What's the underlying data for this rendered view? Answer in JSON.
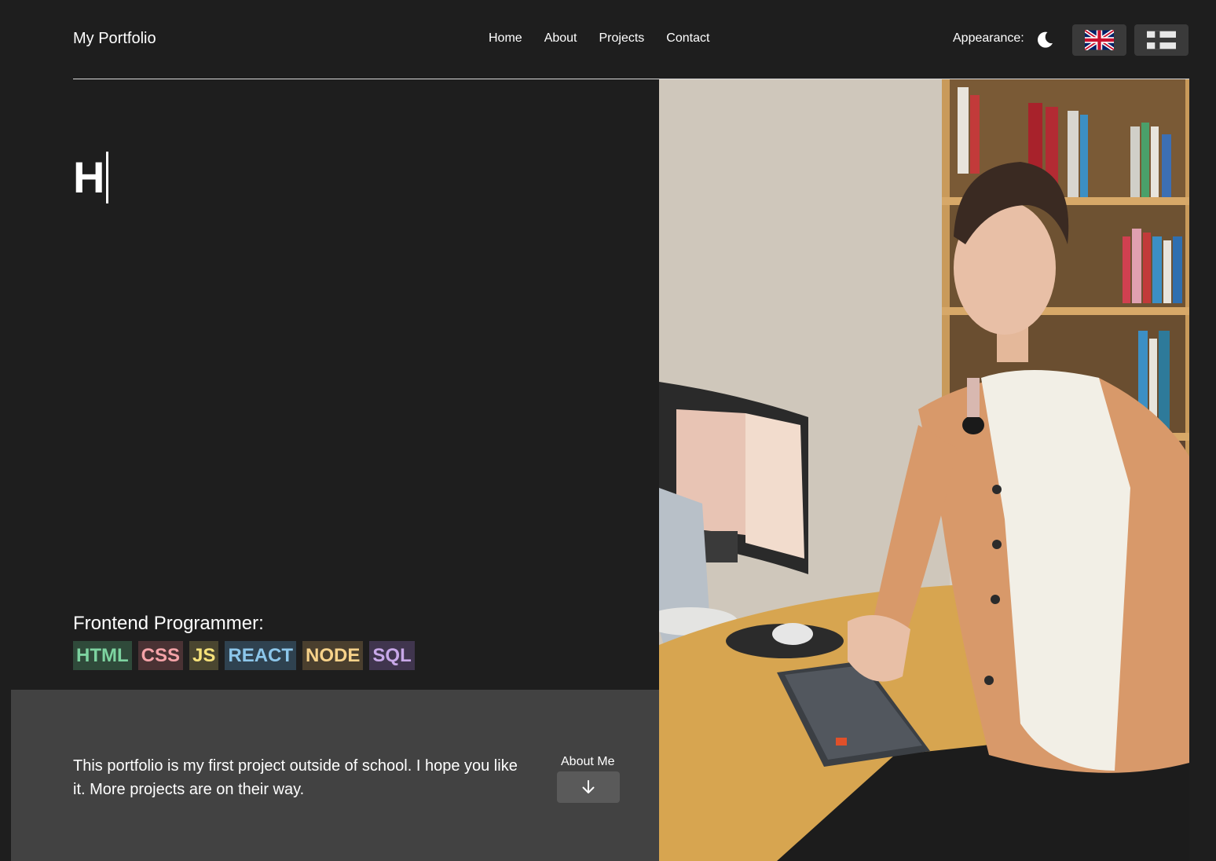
{
  "header": {
    "brand": "My Portfolio",
    "nav": [
      "Home",
      "About",
      "Projects",
      "Contact"
    ],
    "appearance_label": "Appearance:",
    "theme_icon": "moon-icon",
    "languages": [
      "English (UK flag)",
      "Finnish (flag)"
    ]
  },
  "hero": {
    "typed_text": "H",
    "role": "Frontend Programmer:",
    "skills": [
      {
        "label": "HTML",
        "color": "#7dd3a0",
        "bg": "#2f4a3a"
      },
      {
        "label": "CSS",
        "color": "#f4a3a8",
        "bg": "#4a3234"
      },
      {
        "label": "JS",
        "color": "#f6e27a",
        "bg": "#4a4630"
      },
      {
        "label": "REACT",
        "color": "#8cc6ea",
        "bg": "#2f4250"
      },
      {
        "label": "NODE",
        "color": "#f7d28a",
        "bg": "#4a3f2e"
      },
      {
        "label": "SQL",
        "color": "#c8a8e8",
        "bg": "#40354e"
      }
    ]
  },
  "intro": {
    "text": "This portfolio is my first project outside of school. I hope you like it. More projects are on their way.",
    "about_label": "About Me",
    "about_icon": "arrow-down-icon"
  },
  "colors": {
    "background": "#1e1e1e",
    "panel": "#424242",
    "text": "#ffffff"
  }
}
